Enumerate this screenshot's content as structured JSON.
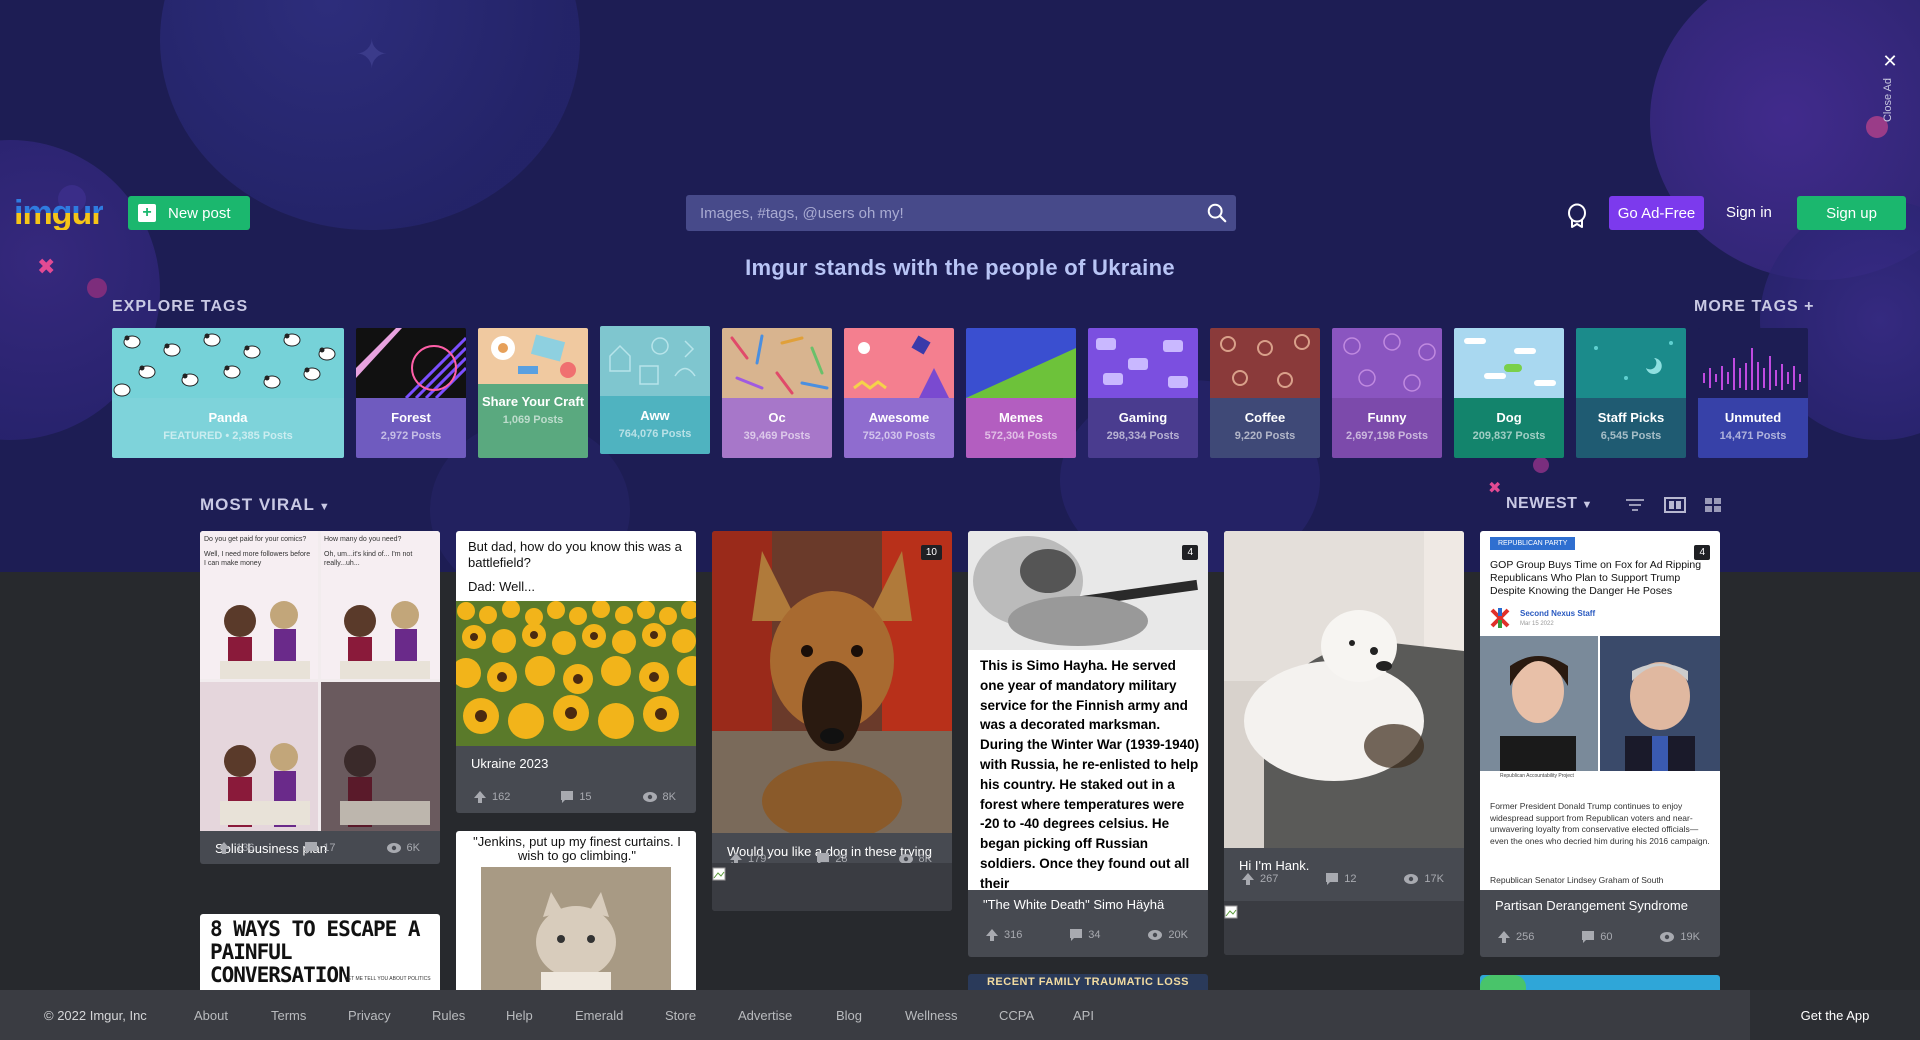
{
  "ad": {
    "close_label": "Close Ad",
    "close_glyph": "✕"
  },
  "header": {
    "logo": "imgur",
    "new_post_label": "New post",
    "search_placeholder": "Images, #tags, @users oh my!",
    "go_ad_free_label": "Go Ad-Free",
    "sign_in_label": "Sign in",
    "sign_up_label": "Sign up"
  },
  "banner": "Imgur stands with the people of Ukraine",
  "explore": {
    "label": "EXPLORE TAGS",
    "more_label": "MORE TAGS +",
    "tags": [
      {
        "name": "Panda",
        "count": "FEATURED • 2,385 Posts",
        "color": "#7ed3da"
      },
      {
        "name": "Forest",
        "count": "2,972 Posts",
        "color": "#6f5bbf"
      },
      {
        "name": "Share Your Craft",
        "count": "1,069 Posts",
        "color": "#5aa97f"
      },
      {
        "name": "Aww",
        "count": "764,076 Posts",
        "color": "#4fb3c0"
      },
      {
        "name": "Oc",
        "count": "39,469 Posts",
        "color": "#a777c9"
      },
      {
        "name": "Awesome",
        "count": "752,030 Posts",
        "color": "#8f6ccf"
      },
      {
        "name": "Memes",
        "count": "572,304 Posts",
        "color": "#b35ec0"
      },
      {
        "name": "Gaming",
        "count": "298,334 Posts",
        "color": "#4a3c8f"
      },
      {
        "name": "Coffee",
        "count": "9,220 Posts",
        "color": "#3f4977"
      },
      {
        "name": "Funny",
        "count": "2,697,198 Posts",
        "color": "#7c4aab"
      },
      {
        "name": "Dog",
        "count": "209,837 Posts",
        "color": "#13846c"
      },
      {
        "name": "Staff Picks",
        "count": "6,545 Posts",
        "color": "#1f5b72"
      },
      {
        "name": "Unmuted",
        "count": "14,471 Posts",
        "color": "#3741a8"
      }
    ]
  },
  "gallery": {
    "sort_label": "MOST VIRAL",
    "order_label": "NEWEST",
    "posts": [
      {
        "title": "Solid business plan",
        "ups": "136",
        "comments": "17",
        "views": "6K",
        "comic": {
          "q1": "Do you get paid for your comics?",
          "a1": "Well, I need more followers before I can make money",
          "q2": "How many do you need?",
          "a2": "Oh, um...it's kind of... I'm not really...uh..."
        }
      },
      {
        "title": "Ukraine 2023",
        "ups": "162",
        "comments": "15",
        "views": "8K",
        "caption": "But dad, how do you know this was a battlefield?",
        "caption2": "Dad: Well..."
      },
      {
        "title": "Would you like a dog in these trying times?",
        "ups": "179",
        "comments": "28",
        "views": "8K",
        "badge": "10"
      },
      {
        "title": "\"The White Death\" Simo Häyhä",
        "ups": "316",
        "comments": "34",
        "views": "20K",
        "badge": "4",
        "text": "This is Simo Hayha. He served one year of mandatory military service for the Finnish army and was a decorated marksman. During the Winter War (1939-1940) with Russia, he re-enlisted to help his country. He staked out in a forest where temperatures were -20 to -40 degrees celsius. He began picking off Russian soldiers. Once they found out all their"
      },
      {
        "title": "Hi I'm Hank.",
        "ups": "267",
        "comments": "12",
        "views": "17K"
      },
      {
        "title": "Partisan Derangement Syndrome",
        "ups": "256",
        "comments": "60",
        "views": "19K",
        "badge": "4",
        "article": {
          "tag": "REPUBLICAN PARTY",
          "headline": "GOP Group Buys Time on Fox for Ad Ripping Republicans Who Plan to Support Trump Despite Knowing the Danger He Poses",
          "author": "Second Nexus Staff",
          "date": "Mar 15 2022",
          "credit": "Republican Accountability Project",
          "body": "Former President Donald Trump continues to enjoy widespread support from Republican voters and near-unwavering loyalty from conservative elected officials—even the ones who decried him during his 2016 campaign.",
          "body2": "Republican Senator Lindsey Graham of South"
        }
      }
    ],
    "partial": {
      "escape_title": "8 WAYS TO ESCAPE A PAINFUL CONVERSATION",
      "escape_small": "LET ME TELL YOU ABOUT POLITICS",
      "jenkins": "\"Jenkins, put up my finest curtains. I wish to go climbing.\"",
      "family": "RECENT FAMILY TRAUMATIC LOSS"
    }
  },
  "footer": {
    "copyright": "© 2022 Imgur, Inc",
    "links": [
      "About",
      "Terms",
      "Privacy",
      "Rules",
      "Help",
      "Emerald",
      "Store",
      "Advertise",
      "Blog",
      "Wellness",
      "CCPA",
      "API"
    ],
    "get_app": "Get the App"
  }
}
